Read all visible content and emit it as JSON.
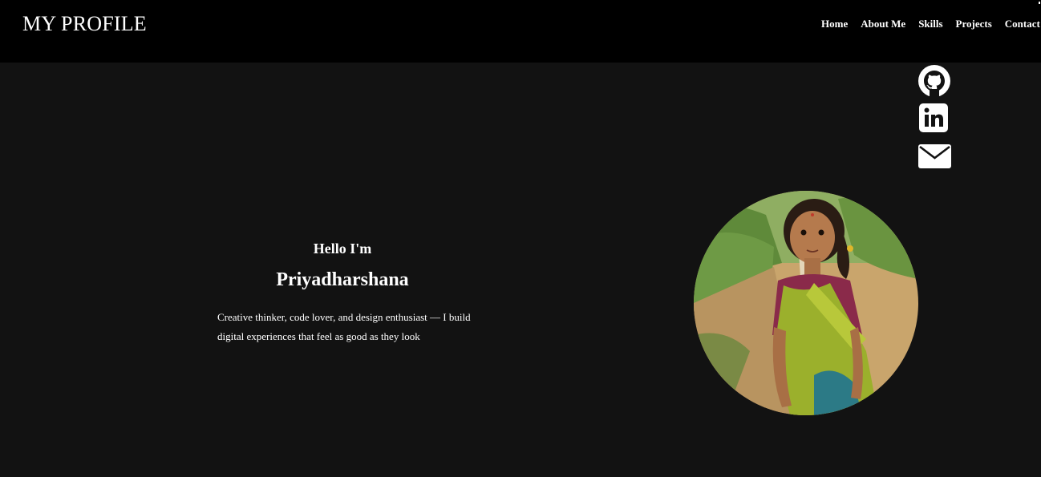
{
  "header": {
    "brand": "MY PROFILE",
    "nav": [
      {
        "label": "Home"
      },
      {
        "label": "About Me"
      },
      {
        "label": "Skills"
      },
      {
        "label": "Projects"
      },
      {
        "label": "Contact"
      }
    ]
  },
  "social": [
    {
      "icon": "github-icon"
    },
    {
      "icon": "linkedin-icon"
    },
    {
      "icon": "mail-icon"
    }
  ],
  "hero": {
    "greeting": "Hello I'm",
    "name": "Priyadharshana",
    "tagline": "Creative thinker, code lover, and design enthusiast — I build digital experiences that feel as good as they look"
  },
  "colors": {
    "navbar_bg": "#000000",
    "page_bg": "#121212",
    "text": "#ffffff"
  }
}
